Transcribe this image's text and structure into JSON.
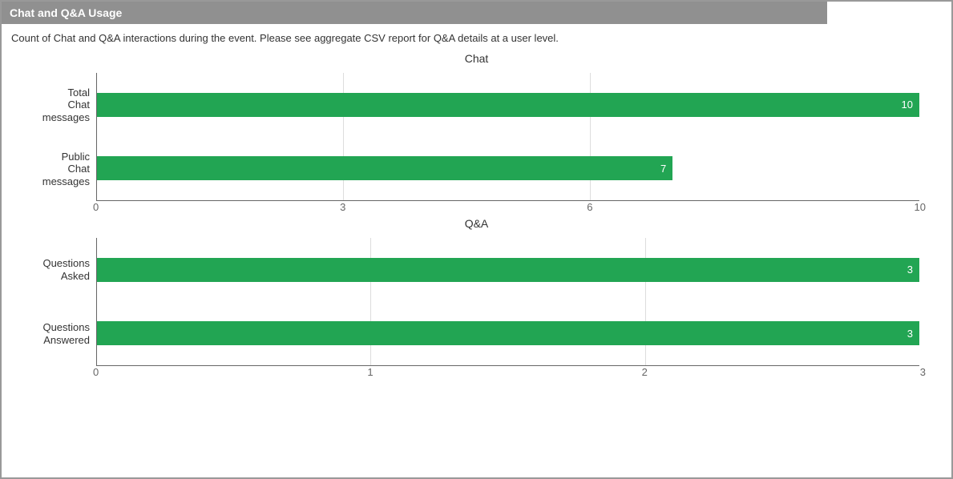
{
  "header": "Chat and Q&A Usage",
  "description": "Count of Chat and Q&A interactions during the event. Please see aggregate CSV report for Q&A details at a user level.",
  "chart_data": [
    {
      "type": "bar",
      "title": "Chat",
      "orientation": "horizontal",
      "categories": [
        "Total Chat messages",
        "Public Chat messages"
      ],
      "values": [
        10,
        7
      ],
      "xlim": [
        0,
        10
      ],
      "xticks": [
        0,
        3,
        6,
        10
      ],
      "bar_color": "#22a553"
    },
    {
      "type": "bar",
      "title": "Q&A",
      "orientation": "horizontal",
      "categories": [
        "Questions Asked",
        "Questions Answered"
      ],
      "values": [
        3,
        3
      ],
      "xlim": [
        0,
        3
      ],
      "xticks": [
        0,
        1,
        2,
        3
      ],
      "bar_color": "#22a553"
    }
  ]
}
